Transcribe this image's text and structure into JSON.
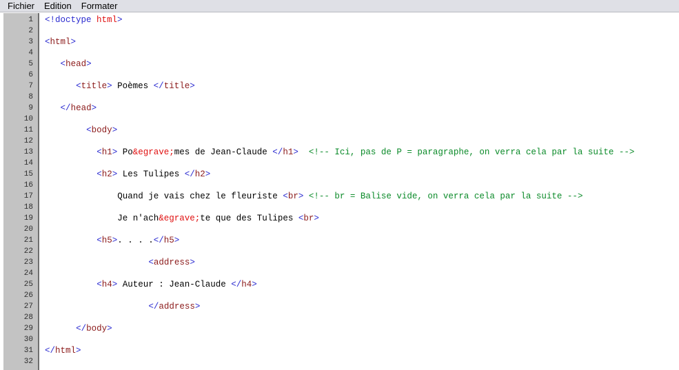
{
  "window": {
    "app_kind": "text-editor",
    "colors": {
      "menubar_bg": "#dfe0e6",
      "gutter_bg": "#c3c3c3",
      "editor_bg": "#ffffff",
      "bracket": "#2a2ad0",
      "tagname": "#8b1a1a",
      "text": "#000000",
      "entity": "#e01010",
      "comment": "#0a8a28"
    }
  },
  "menubar": {
    "items": [
      {
        "label": "Fichier"
      },
      {
        "label": "Edition"
      },
      {
        "label": "Formater"
      }
    ]
  },
  "editor": {
    "line_numbers": [
      "1",
      "2",
      "3",
      "4",
      "5",
      "6",
      "7",
      "8",
      "9",
      "10",
      "11",
      "12",
      "13",
      "14",
      "15",
      "16",
      "17",
      "18",
      "19",
      "20",
      "21",
      "22",
      "23",
      "24",
      "25",
      "26",
      "27",
      "28",
      "29",
      "30",
      "31",
      "32"
    ],
    "total_lines": 32,
    "language": "html",
    "lines": [
      {
        "n": "1",
        "indent": 0,
        "text": "<!doctype html>"
      },
      {
        "n": "2",
        "indent": 0,
        "text": ""
      },
      {
        "n": "3",
        "indent": 0,
        "text": "<html>"
      },
      {
        "n": "4",
        "indent": 0,
        "text": ""
      },
      {
        "n": "5",
        "indent": 3,
        "text": "<head>"
      },
      {
        "n": "6",
        "indent": 0,
        "text": ""
      },
      {
        "n": "7",
        "indent": 6,
        "text": "<title> Poèmes </title>"
      },
      {
        "n": "8",
        "indent": 0,
        "text": ""
      },
      {
        "n": "9",
        "indent": 3,
        "text": "</head>"
      },
      {
        "n": "10",
        "indent": 0,
        "text": ""
      },
      {
        "n": "11",
        "indent": 8,
        "text": "<body>"
      },
      {
        "n": "12",
        "indent": 0,
        "text": ""
      },
      {
        "n": "13",
        "indent": 10,
        "text": "<h1> Po&egrave;mes de Jean-Claude </h1>  <!-- Ici, pas de P = paragraphe, on verra cela par la suite -->"
      },
      {
        "n": "14",
        "indent": 0,
        "text": ""
      },
      {
        "n": "15",
        "indent": 10,
        "text": "<h2> Les Tulipes </h2>"
      },
      {
        "n": "16",
        "indent": 0,
        "text": ""
      },
      {
        "n": "17",
        "indent": 14,
        "text": "Quand je vais chez le fleuriste <br> <!-- br = Balise vide, on verra cela par la suite -->"
      },
      {
        "n": "18",
        "indent": 0,
        "text": ""
      },
      {
        "n": "19",
        "indent": 14,
        "text": "Je n'ach&egrave;te que des Tulipes <br>"
      },
      {
        "n": "20",
        "indent": 0,
        "text": ""
      },
      {
        "n": "21",
        "indent": 10,
        "text": "<h5>. . . .</h5>"
      },
      {
        "n": "22",
        "indent": 0,
        "text": ""
      },
      {
        "n": "23",
        "indent": 20,
        "text": "<address>"
      },
      {
        "n": "24",
        "indent": 0,
        "text": ""
      },
      {
        "n": "25",
        "indent": 10,
        "text": "<h4> Auteur : Jean-Claude </h4>"
      },
      {
        "n": "26",
        "indent": 0,
        "text": ""
      },
      {
        "n": "27",
        "indent": 20,
        "text": "</address>"
      },
      {
        "n": "28",
        "indent": 0,
        "text": ""
      },
      {
        "n": "29",
        "indent": 6,
        "text": "</body>"
      },
      {
        "n": "30",
        "indent": 0,
        "text": ""
      },
      {
        "n": "31",
        "indent": 0,
        "text": "</html>"
      },
      {
        "n": "32",
        "indent": 0,
        "text": ""
      }
    ],
    "tokens": [
      [
        {
          "t": "<!doctype ",
          "c": "dct"
        },
        {
          "t": "html",
          "c": "ent"
        },
        {
          "t": ">",
          "c": "br"
        }
      ],
      [],
      [
        {
          "t": "<",
          "c": "br"
        },
        {
          "t": "html",
          "c": "tag"
        },
        {
          "t": ">",
          "c": "br"
        }
      ],
      [],
      [
        {
          "t": "<",
          "c": "br"
        },
        {
          "t": "head",
          "c": "tag"
        },
        {
          "t": ">",
          "c": "br"
        }
      ],
      [],
      [
        {
          "t": "<",
          "c": "br"
        },
        {
          "t": "title",
          "c": "tag"
        },
        {
          "t": ">",
          "c": "br"
        },
        {
          "t": " Poèmes ",
          "c": "txt"
        },
        {
          "t": "</",
          "c": "br"
        },
        {
          "t": "title",
          "c": "tag"
        },
        {
          "t": ">",
          "c": "br"
        }
      ],
      [],
      [
        {
          "t": "</",
          "c": "br"
        },
        {
          "t": "head",
          "c": "tag"
        },
        {
          "t": ">",
          "c": "br"
        }
      ],
      [],
      [
        {
          "t": "<",
          "c": "br"
        },
        {
          "t": "body",
          "c": "tag"
        },
        {
          "t": ">",
          "c": "br"
        }
      ],
      [],
      [
        {
          "t": "<",
          "c": "br"
        },
        {
          "t": "h1",
          "c": "tag"
        },
        {
          "t": ">",
          "c": "br"
        },
        {
          "t": " Po",
          "c": "txt"
        },
        {
          "t": "&egrave;",
          "c": "ent"
        },
        {
          "t": "mes de Jean-Claude ",
          "c": "txt"
        },
        {
          "t": "</",
          "c": "br"
        },
        {
          "t": "h1",
          "c": "tag"
        },
        {
          "t": ">",
          "c": "br"
        },
        {
          "t": "  ",
          "c": "txt"
        },
        {
          "t": "<!-- Ici, pas de P = paragraphe, on verra cela par la suite -->",
          "c": "cmt"
        }
      ],
      [],
      [
        {
          "t": "<",
          "c": "br"
        },
        {
          "t": "h2",
          "c": "tag"
        },
        {
          "t": ">",
          "c": "br"
        },
        {
          "t": " Les Tulipes ",
          "c": "txt"
        },
        {
          "t": "</",
          "c": "br"
        },
        {
          "t": "h2",
          "c": "tag"
        },
        {
          "t": ">",
          "c": "br"
        }
      ],
      [],
      [
        {
          "t": "Quand je vais chez le fleuriste ",
          "c": "txt"
        },
        {
          "t": "<",
          "c": "br"
        },
        {
          "t": "br",
          "c": "tag"
        },
        {
          "t": ">",
          "c": "br"
        },
        {
          "t": " ",
          "c": "txt"
        },
        {
          "t": "<!-- br = Balise vide, on verra cela par la suite -->",
          "c": "cmt"
        }
      ],
      [],
      [
        {
          "t": "Je n'ach",
          "c": "txt"
        },
        {
          "t": "&egrave;",
          "c": "ent"
        },
        {
          "t": "te que des Tulipes ",
          "c": "txt"
        },
        {
          "t": "<",
          "c": "br"
        },
        {
          "t": "br",
          "c": "tag"
        },
        {
          "t": ">",
          "c": "br"
        }
      ],
      [],
      [
        {
          "t": "<",
          "c": "br"
        },
        {
          "t": "h5",
          "c": "tag"
        },
        {
          "t": ">",
          "c": "br"
        },
        {
          "t": ". . . .",
          "c": "txt"
        },
        {
          "t": "</",
          "c": "br"
        },
        {
          "t": "h5",
          "c": "tag"
        },
        {
          "t": ">",
          "c": "br"
        }
      ],
      [],
      [
        {
          "t": "<",
          "c": "br"
        },
        {
          "t": "address",
          "c": "tag"
        },
        {
          "t": ">",
          "c": "br"
        }
      ],
      [],
      [
        {
          "t": "<",
          "c": "br"
        },
        {
          "t": "h4",
          "c": "tag"
        },
        {
          "t": ">",
          "c": "br"
        },
        {
          "t": " Auteur : Jean-Claude ",
          "c": "txt"
        },
        {
          "t": "</",
          "c": "br"
        },
        {
          "t": "h4",
          "c": "tag"
        },
        {
          "t": ">",
          "c": "br"
        }
      ],
      [],
      [
        {
          "t": "</",
          "c": "br"
        },
        {
          "t": "address",
          "c": "tag"
        },
        {
          "t": ">",
          "c": "br"
        }
      ],
      [],
      [
        {
          "t": "</",
          "c": "br"
        },
        {
          "t": "body",
          "c": "tag"
        },
        {
          "t": ">",
          "c": "br"
        }
      ],
      [],
      [
        {
          "t": "</",
          "c": "br"
        },
        {
          "t": "html",
          "c": "tag"
        },
        {
          "t": ">",
          "c": "br"
        }
      ],
      []
    ]
  }
}
